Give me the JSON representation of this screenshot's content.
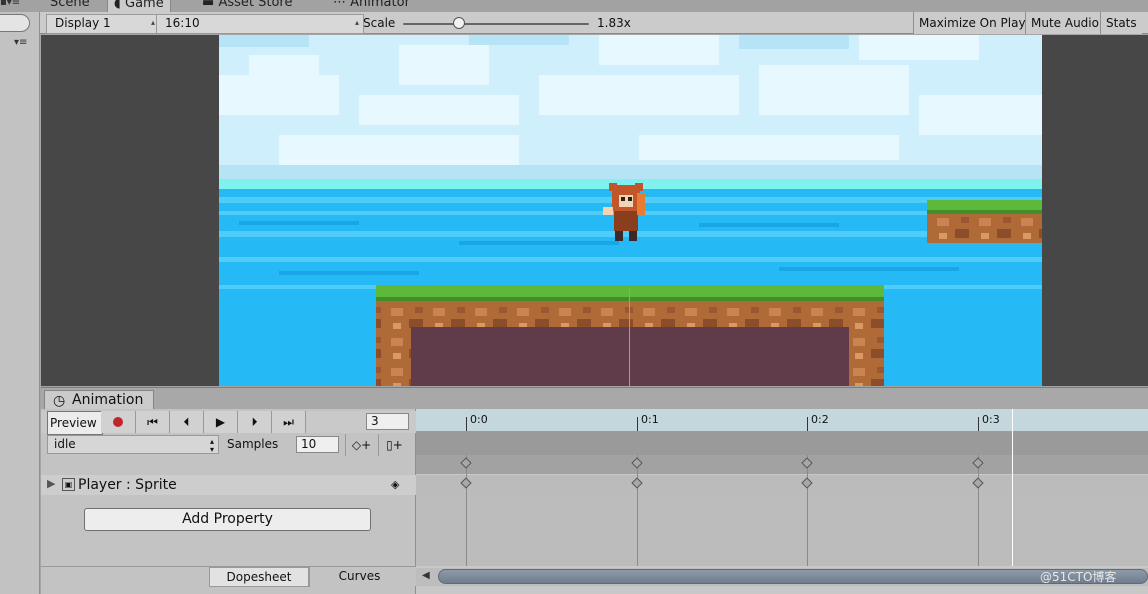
{
  "tabs": [
    {
      "label": "Scene",
      "icon": "scene-icon"
    },
    {
      "label": "Game",
      "icon": "pacman-icon"
    },
    {
      "label": "Asset Store",
      "icon": "store-icon"
    },
    {
      "label": "Animator",
      "icon": "animator-icon"
    }
  ],
  "game_toolbar": {
    "display": "Display 1",
    "aspect": "16:10",
    "scale_label": "Scale",
    "scale_value": "1.83x",
    "scale_fraction": 0.3,
    "maximize": "Maximize On Play",
    "mute": "Mute Audio",
    "stats": "Stats"
  },
  "animation": {
    "tab_label": "Animation",
    "preview_label": "Preview",
    "frame": "3",
    "clip": "idle",
    "samples_label": "Samples",
    "samples": "10",
    "property": "Player : Sprite",
    "add_property": "Add Property",
    "dopesheet": "Dopesheet",
    "curves": "Curves",
    "ticks": [
      "0:0",
      "0:1",
      "0:2",
      "0:3"
    ],
    "keyframe_ticks": [
      0,
      1,
      2,
      3
    ],
    "playhead_frame": 3.2
  },
  "watermark": "@51CTO博客",
  "colors": {
    "record": "#c0272d",
    "sky": "#cfefff",
    "sea": "#25b9f5",
    "grass": "#5eb93a",
    "dirt": "#b5703a",
    "dark_dirt": "#603c4a"
  }
}
